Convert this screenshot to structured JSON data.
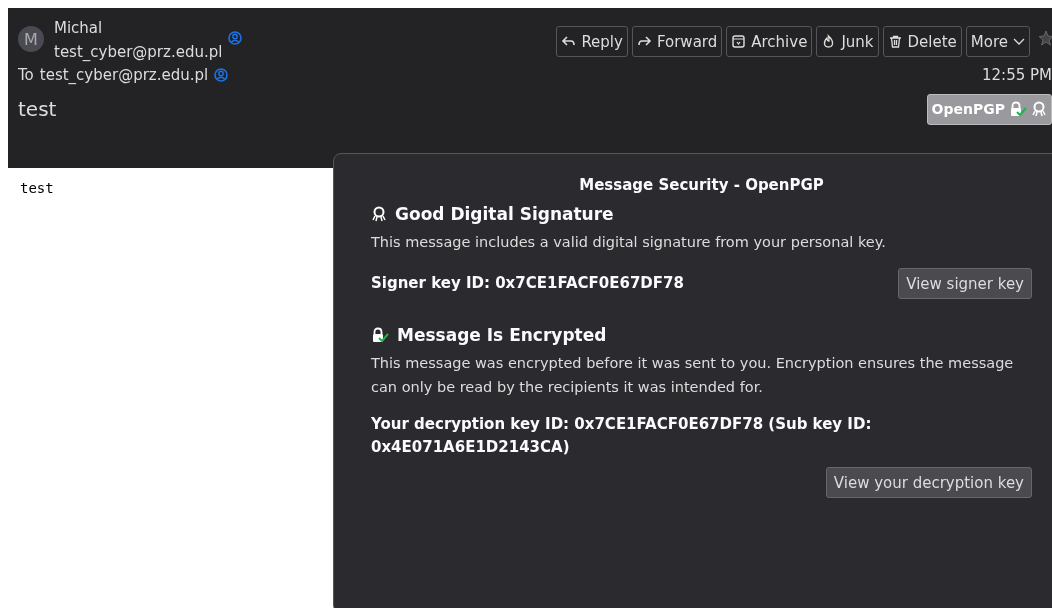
{
  "sender": {
    "avatar": "M",
    "name": "Michal",
    "email": "test_cyber@prz.edu.pl"
  },
  "toolbar": [
    {
      "label": "Reply",
      "kind": "reply"
    },
    {
      "label": "Forward",
      "kind": "forward"
    },
    {
      "label": "Archive",
      "kind": "archive"
    },
    {
      "label": "Junk",
      "kind": "junk"
    },
    {
      "label": "Delete",
      "kind": "delete"
    },
    {
      "label": "More",
      "kind": "more"
    }
  ],
  "recipient": {
    "label": "To",
    "email": "test_cyber@prz.edu.pl"
  },
  "time": "12:55 PM",
  "subject": "test",
  "security_badge": {
    "label": "OpenPGP"
  },
  "body": "test",
  "popup": {
    "title": "Message Security - OpenPGP",
    "sections": [
      {
        "kind": "signature",
        "heading": "Good Digital Signature",
        "description": "This message includes a valid digital signature from your personal key.",
        "key_info": "Signer key ID: 0x7CE1FACF0E67DF78",
        "button": "View signer key"
      },
      {
        "kind": "encryption",
        "heading": "Message Is Encrypted",
        "description": "This message was encrypted before it was sent to you. Encryption ensures the message can only be read by the recipients it was intended for.",
        "key_info": "Your decryption key ID: 0x7CE1FACF0E67DF78 (Sub key ID: 0x4E071A6E1D2143CA)",
        "button": "View your decryption key"
      }
    ]
  }
}
